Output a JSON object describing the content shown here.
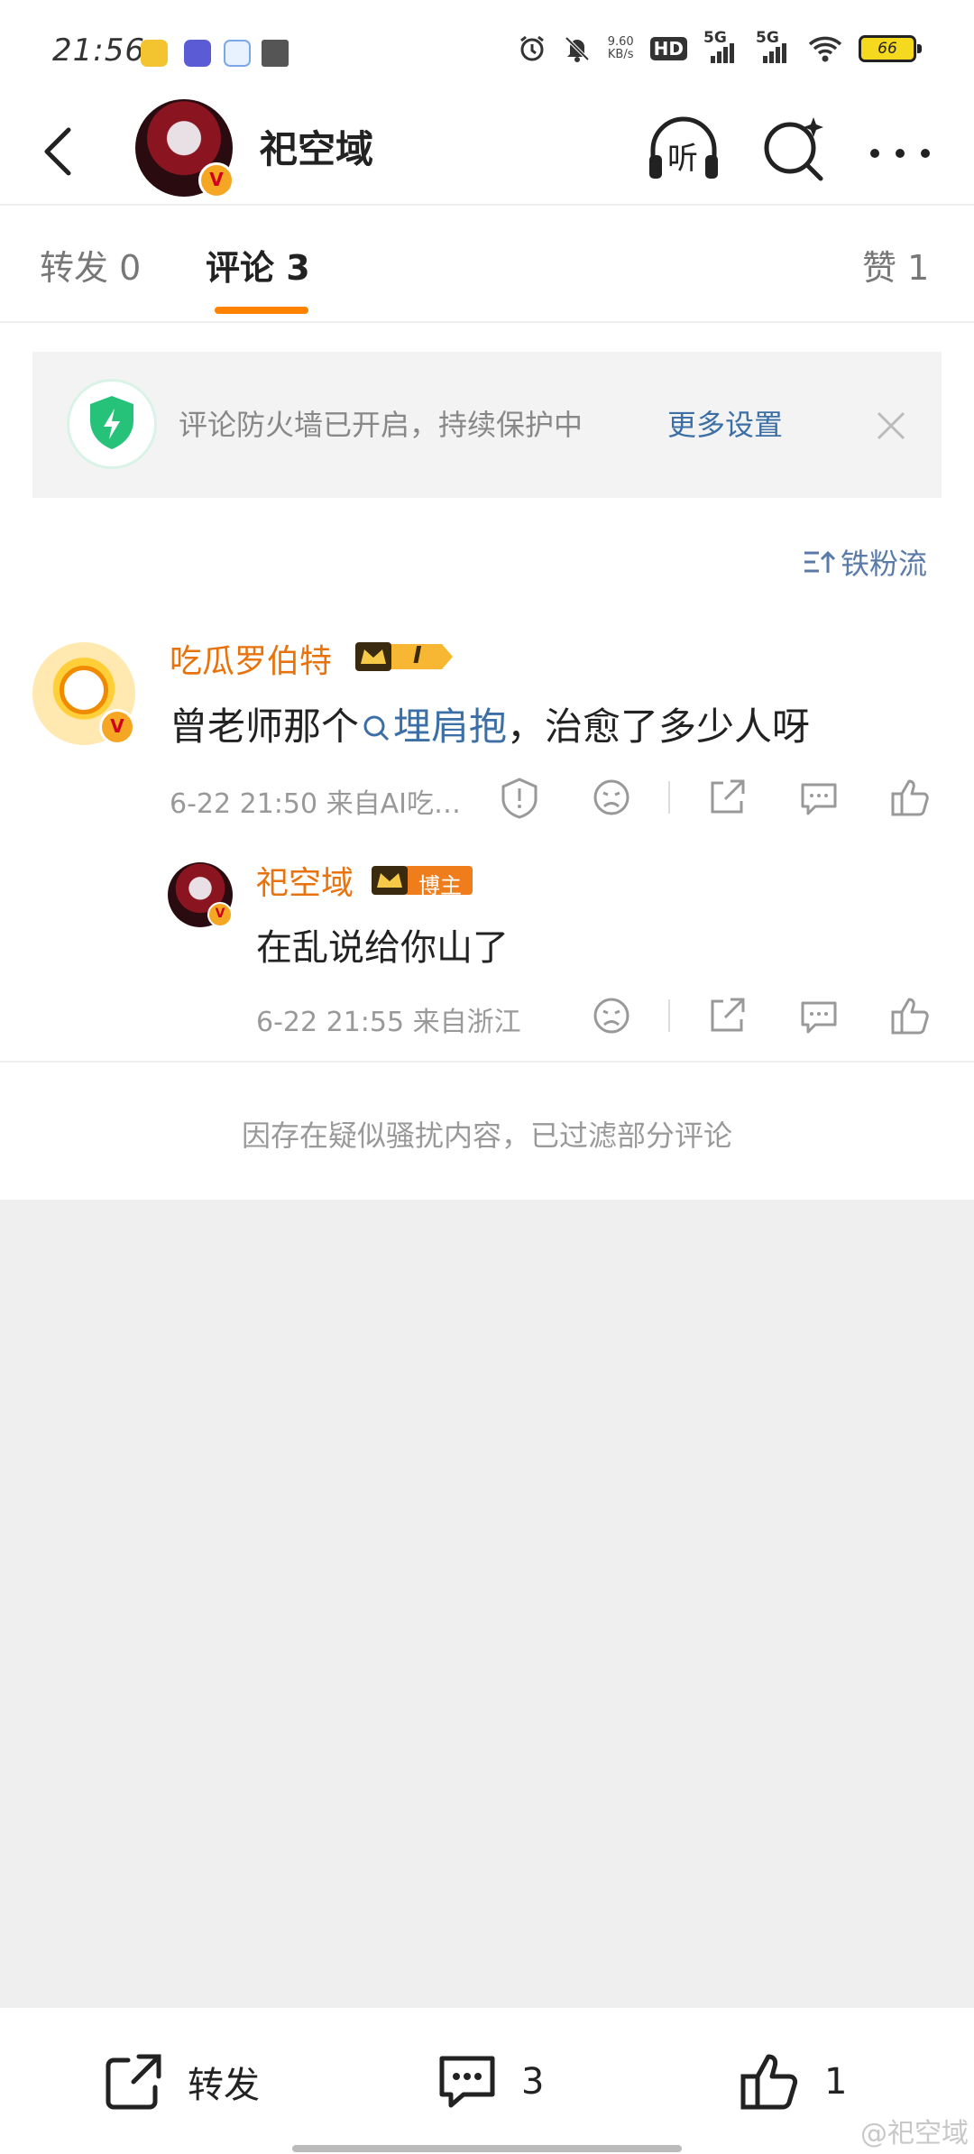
{
  "status_bar": {
    "time": "21:56",
    "net_speed_value": "9.60",
    "net_speed_unit": "KB/s",
    "hd": "HD",
    "signal1": "5G",
    "signal2": "5G",
    "battery": "66"
  },
  "header": {
    "name": "祀空域",
    "listen_label": "听"
  },
  "tabs": [
    {
      "label": "转发 0"
    },
    {
      "label": "评论 3"
    },
    {
      "label": "赞 1"
    }
  ],
  "banner": {
    "text": "评论防火墙已开启，持续保护中",
    "link": "更多设置"
  },
  "sort": {
    "label": "铁粉流"
  },
  "comment": {
    "user": "吃瓜罗伯特",
    "vip_level": "I",
    "text_before": "曾老师那个",
    "topic": "埋肩抱",
    "text_after": "，治愈了多少人呀",
    "meta": "6-22 21:50  来自AI吃…"
  },
  "reply": {
    "user": "祀空域",
    "badge": "博主",
    "text": "在乱说给你山了",
    "meta": "6-22 21:55  来自浙江"
  },
  "filter_note": "因存在疑似骚扰内容，已过滤部分评论",
  "bottom_bar": {
    "repost": "转发",
    "comments": "3",
    "likes": "1"
  },
  "watermark": "@祀空域",
  "colors": {
    "accent_orange": "#ff8200",
    "username_orange": "#e8720c",
    "link_blue": "#3b6fa6",
    "shield_green": "#27c27a"
  }
}
